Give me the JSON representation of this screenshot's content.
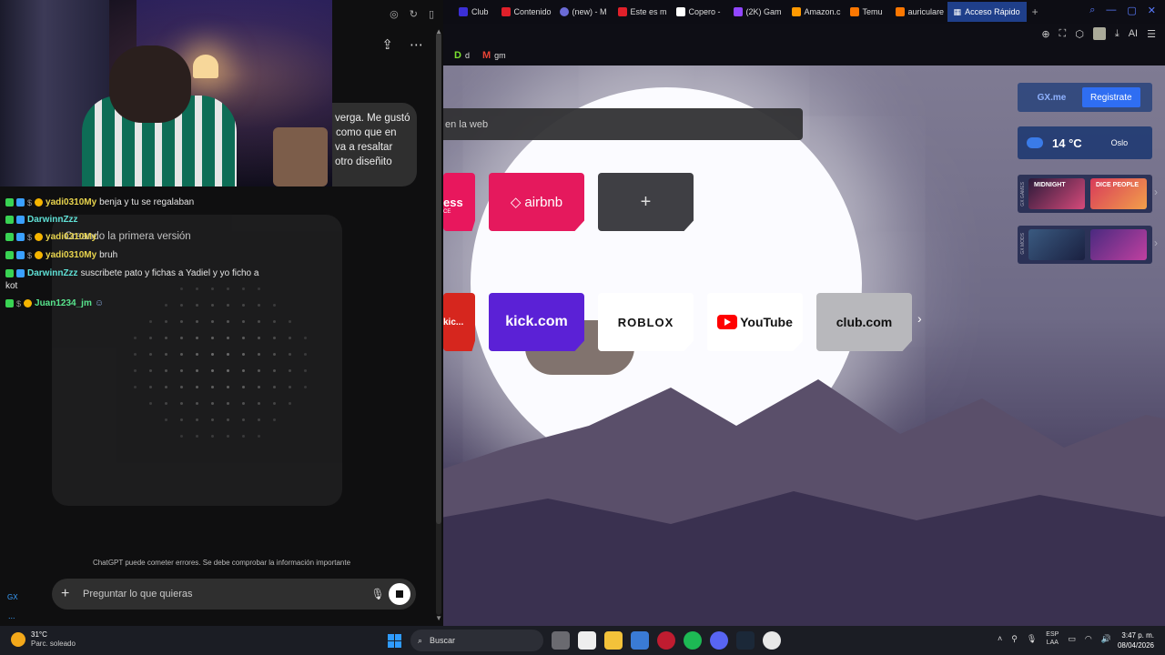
{
  "chatgpt": {
    "bubble_lines": [
      "verga. Me gustó",
      "como que en",
      "va a resaltar",
      "otro diseñito"
    ],
    "thinking_title": "Creando la primera versión",
    "disclaimer": "ChatGPT puede cometer errores. Se debe comprobar la información importante",
    "composer_placeholder": "Preguntar lo que quieras",
    "share_icon": "share-icon",
    "more_icon": "more-options-icon"
  },
  "twitch_chat": {
    "lines": [
      {
        "user": "yadi0310My",
        "msg": "benja y tu se regalaban"
      },
      {
        "user": "DarwinnZzz",
        "msg": ""
      },
      {
        "user": "yadi0310My",
        "msg": ""
      },
      {
        "user": "yadi0310My",
        "msg": "bruh"
      },
      {
        "user": "DarwinnZzz",
        "msg": "suscribete pato y fichas a Yadiel y yo ficho a"
      },
      {
        "user": "Juan1234_jm",
        "msg": ""
      }
    ],
    "wrap": "kot"
  },
  "left_rail": {
    "gx": "GX",
    "dots": "..."
  },
  "browser": {
    "tabs": [
      {
        "label": "Club",
        "color": "#3b2fd6"
      },
      {
        "label": "Contenido",
        "color": "#e0202a"
      },
      {
        "label": "(new) - M",
        "color": "#6b6bd6"
      },
      {
        "label": "Este es m",
        "color": "#e0202a"
      },
      {
        "label": "Copero -",
        "color": "#ffffff"
      },
      {
        "label": "(2K) Gam",
        "color": "#9146ff"
      },
      {
        "label": "Amazon.c",
        "color": "#ff9900"
      },
      {
        "label": "Temu",
        "color": "#fb7701"
      },
      {
        "label": "auriculare",
        "color": "#fb7701"
      },
      {
        "label": "Acceso Rápido",
        "color": "#1f3f8a"
      }
    ],
    "new_tab": "+",
    "bookmarks": [
      {
        "icon": "D",
        "label": "d"
      },
      {
        "icon": "M",
        "label": "gm"
      }
    ],
    "toolbar_ai": "AI",
    "search_placeholder": "en la web",
    "tiles_row1": {
      "express": "ess",
      "express_sub": "CE",
      "airbnb": "airbnb",
      "add": "+"
    },
    "tiles_row2": {
      "kic": "kic...",
      "kick": "kick.com",
      "roblox": "ROBLOX",
      "youtube": "YouTube",
      "club": "club.com"
    },
    "next": "›",
    "gx_me": "GX.me",
    "register": "Registrate",
    "temperature": "14 °C",
    "city": "Oslo",
    "games_label": "GX GAMES",
    "mods_label": "GX MODS",
    "game1": "MIDNIGHT",
    "game2": "DICE PEOPLE"
  },
  "taskbar": {
    "temp": "31°C",
    "condition": "Parc. soleado",
    "search": "Buscar",
    "lang1": "ESP",
    "lang2": "LAA",
    "time": "3:47 p. m.",
    "date": "08/04/2026"
  }
}
